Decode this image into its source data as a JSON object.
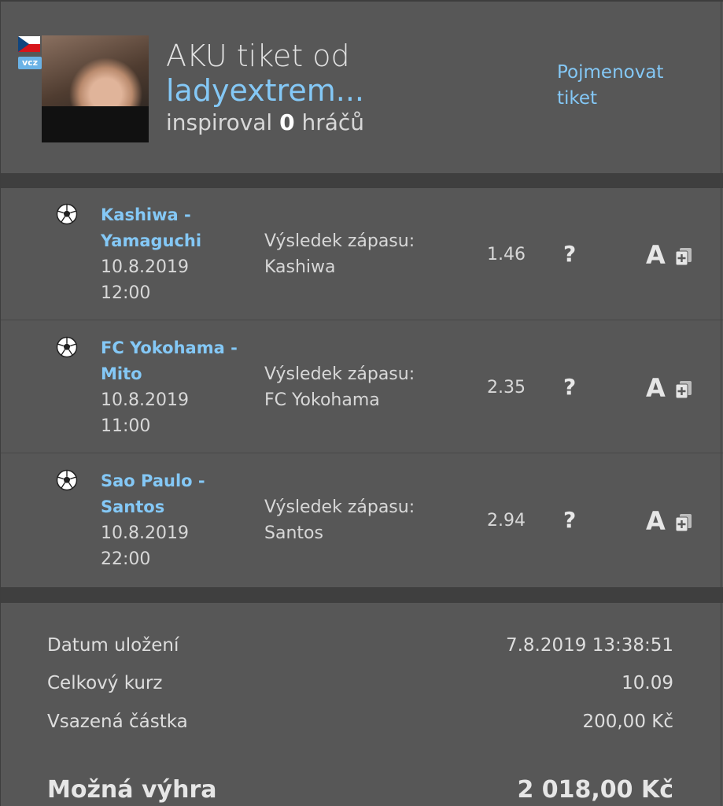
{
  "header": {
    "flag_icon": "czech-flag-icon",
    "vcz_badge": "vcz",
    "title_prefix": "AKU tiket od",
    "username": "ladyextrem...",
    "inspired_prefix": "inspiroval",
    "inspired_count": "0",
    "inspired_suffix": "hráčů",
    "rename_label": "Pojmenovat tiket"
  },
  "bets": [
    {
      "sport_icon": "soccer-ball-icon",
      "match": "Kashiwa - Yamaguchi",
      "date": "10.8.2019",
      "time": "12:00",
      "market": "Výsledek zápasu:",
      "pick": "Kashiwa",
      "odds": "1.46",
      "status": "?",
      "action_a": "A"
    },
    {
      "sport_icon": "soccer-ball-icon",
      "match": "FC Yokohama - Mito",
      "date": "10.8.2019",
      "time": "11:00",
      "market": "Výsledek zápasu:",
      "pick": "FC Yokohama",
      "odds": "2.35",
      "status": "?",
      "action_a": "A"
    },
    {
      "sport_icon": "soccer-ball-icon",
      "match": "Sao Paulo - Santos",
      "date": "10.8.2019",
      "time": "22:00",
      "market": "Výsledek zápasu:",
      "pick": "Santos",
      "odds": "2.94",
      "status": "?",
      "action_a": "A"
    }
  ],
  "summary": {
    "saved_label": "Datum uložení",
    "saved_value": "7.8.2019 13:38:51",
    "total_odds_label": "Celkový kurz",
    "total_odds_value": "10.09",
    "stake_label": "Vsazená částka",
    "stake_value": "200,00 Kč",
    "win_label": "Možná výhra",
    "win_value": "2 018,00 Kč"
  },
  "colors": {
    "background": "#575757",
    "separator": "#3f3f3f",
    "link": "#84c8f6",
    "text": "#d8d8d8"
  }
}
